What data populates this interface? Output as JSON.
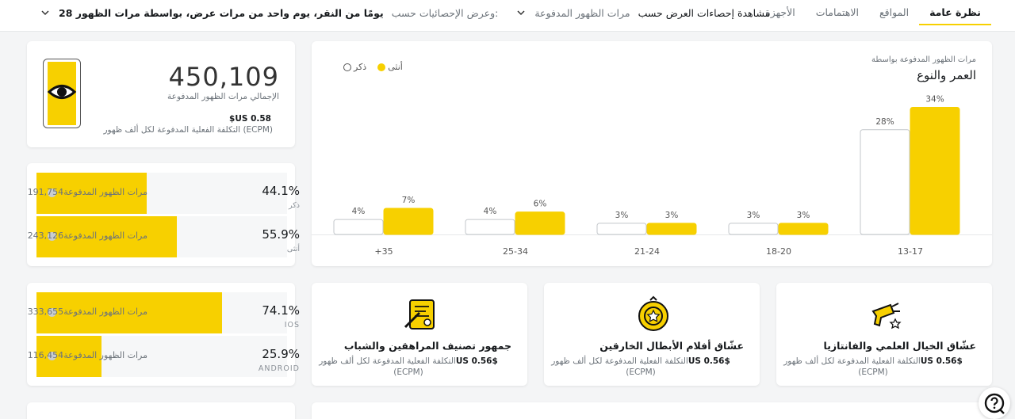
{
  "tabs": [
    {
      "label": "نظرة عامة",
      "active": true
    },
    {
      "label": "المواقع"
    },
    {
      "label": "الاهتمامات"
    },
    {
      "label": "الأجهزة"
    }
  ],
  "filters": {
    "view_by_label": "مشاهدة إحصاءات العرض حسب",
    "view_by_value": "مرات الظهور المدفوعة",
    "display_label": "وعرض الإحصائيات حسب:",
    "display_value": "28 يومًا من النقر، يوم واحد من مرات عرض، بواسطة مرات الظهور"
  },
  "summary": {
    "total": "450,109",
    "total_label": "الإجمالي مرات الظهور المدفوعة",
    "ecpm_value": "$US 0.58",
    "ecpm_label": "التكلفة الفعلية المدفوعة لكل ألف ظهور (ECPM)"
  },
  "gender": [
    {
      "pct": "44.1%",
      "caption": "ذكر",
      "count": "191,754",
      "label": "مرات الظهور المدفوعة",
      "share": 0.441
    },
    {
      "pct": "55.9%",
      "caption": "أنثى",
      "count": "243,126",
      "label": "مرات الظهور المدفوعة",
      "share": 0.559
    }
  ],
  "os": [
    {
      "pct": "74.1%",
      "caption": "IOS",
      "count": "333,655",
      "label": "مرات الظهور المدفوعة",
      "share": 0.741
    },
    {
      "pct": "25.9%",
      "caption": "ANDROID",
      "count": "116,454",
      "label": "مرات الظهور المدفوعة",
      "share": 0.259
    }
  ],
  "chart_data": {
    "type": "bar",
    "title_line1": "مرات الظهور المدفوعة بواسطة",
    "title_line2": "العمر والنوع",
    "categories": [
      "13-17",
      "18-20",
      "21-24",
      "25-34",
      "+35"
    ],
    "series": [
      {
        "name": "أنثى",
        "values": [
          34,
          3,
          3,
          6,
          7
        ],
        "color": "#f7d000"
      },
      {
        "name": "ذكر",
        "values": [
          28,
          3,
          3,
          4,
          4
        ],
        "color": "#ffffff"
      }
    ],
    "ylim": [
      0,
      36
    ],
    "legend": "top-left",
    "grid": false
  },
  "interests": [
    {
      "name": "عشّاق الخيال العلمي والفانتازيا",
      "cpm_value": "$US 0.56",
      "cpm_label": "التكلفة الفعلية المدفوعة لكل ألف ظهور (ECPM)",
      "icon": "ray-gun-icon"
    },
    {
      "name": "عشّاق أفلام الأبطال الخارقين",
      "cpm_value": "$US 0.56",
      "cpm_label": "التكلفة الفعلية المدفوعة لكل ألف ظهور (ECPM)",
      "icon": "hero-medal-icon"
    },
    {
      "name": "جمهور تصنيف المراهقين والشباب",
      "cpm_value": "$US 0.56",
      "cpm_label": "التكلفة الفعلية المدفوعة لكل ألف ظهور (ECPM)",
      "icon": "book-icon"
    }
  ],
  "colors": {
    "accent": "#f7d000",
    "text": "#16191c",
    "muted": "#6c737a"
  }
}
